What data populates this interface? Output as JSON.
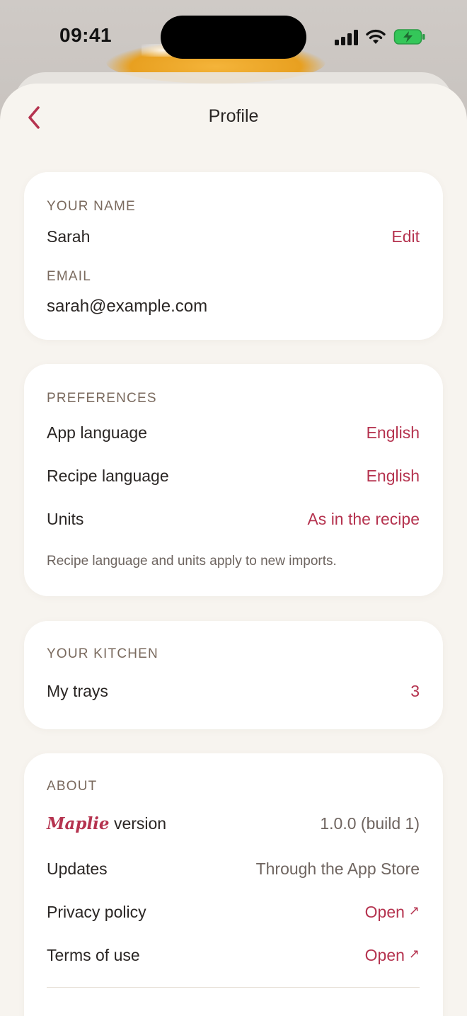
{
  "status_bar": {
    "time": "09:41",
    "icons": [
      "signal-icon",
      "wifi-icon",
      "battery-charging-icon"
    ]
  },
  "nav": {
    "title": "Profile",
    "back_icon": "chevron-left-icon"
  },
  "account": {
    "name_label": "YOUR NAME",
    "name_value": "Sarah",
    "edit_label": "Edit",
    "email_label": "EMAIL",
    "email_value": "sarah@example.com"
  },
  "preferences": {
    "section_label": "PREFERENCES",
    "rows": [
      {
        "label": "App language",
        "value": "English"
      },
      {
        "label": "Recipe language",
        "value": "English"
      },
      {
        "label": "Units",
        "value": "As in the recipe"
      }
    ],
    "note": "Recipe language and units apply to new imports."
  },
  "kitchen": {
    "section_label": "YOUR KITCHEN",
    "trays_label": "My trays",
    "trays_count": "3"
  },
  "about": {
    "section_label": "ABOUT",
    "brand_name": "Maplie",
    "version_label": "version",
    "version_value": "1.0.0 (build 1)",
    "updates_label": "Updates",
    "updates_value": "Through the App Store",
    "privacy_label": "Privacy policy",
    "privacy_value": "Open",
    "terms_label": "Terms of use",
    "terms_value": "Open",
    "external_icon": "↗"
  },
  "colors": {
    "accent": "#b5334f",
    "sheet_bg": "#f7f4ef",
    "card_bg": "#ffffff",
    "section_label": "#7a6a5e",
    "text": "#2a2624",
    "battery_green": "#34c759"
  }
}
